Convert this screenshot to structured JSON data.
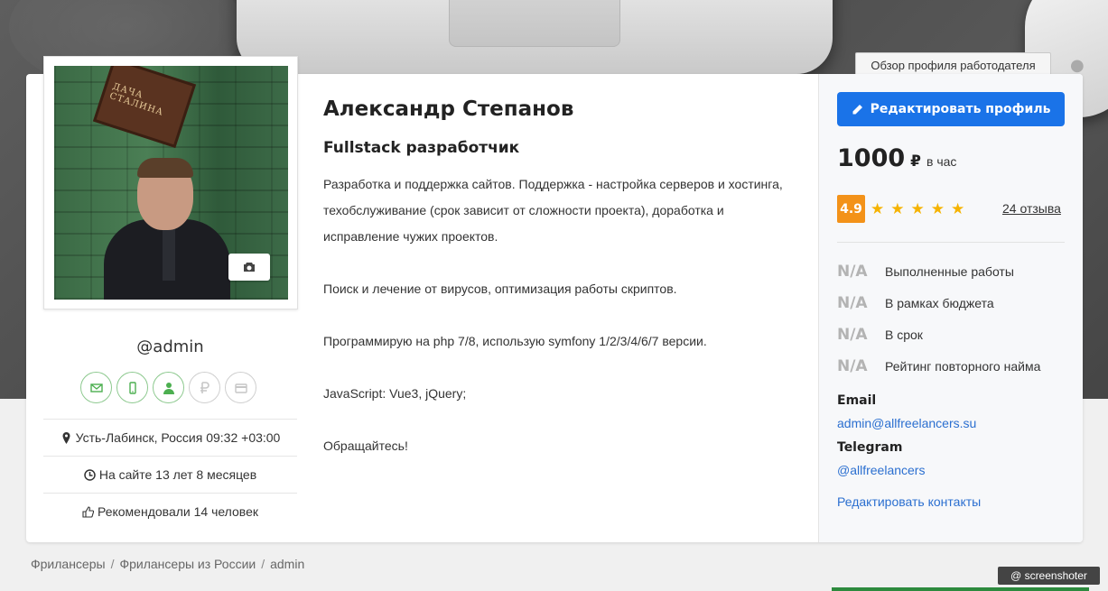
{
  "header": {
    "employer_view_label": "Обзор профиля работодателя"
  },
  "profile": {
    "name": "Александр Степанов",
    "specialization": "Fullstack разработчик",
    "description": "Разработка и поддержка сайтов. Поддержка - настройка серверов и хостинга, техобслуживание (срок зависит от сложности проекта), доработка и исправление чужих проектов.\n\nПоиск и лечение от вирусов, оптимизация работы скриптов.\n\nПрограммирую на php 7/8, использую symfony 1/2/3/4/6/7 версии.\n\nJavaScript: Vue3, jQuery;\n\nОбращайтесь!",
    "username": "@admin",
    "photo_sign_text": "ДАЧА СТАЛИНА",
    "location": "Усть-Лабинск, Россия 09:32 +03:00",
    "on_site": "На сайте 13 лет 8 месяцев",
    "recommended": "Рекомендовали 14 человек"
  },
  "sidebar": {
    "edit_profile_label": "Редактировать профиль",
    "rate_value": "1000",
    "rate_currency": "₽",
    "rate_unit": "в час",
    "rating": "4.9",
    "stars": 5,
    "reviews_label": "24 отзыва",
    "stats": [
      {
        "value": "N/A",
        "label": "Выполненные работы"
      },
      {
        "value": "N/A",
        "label": "В рамках бюджета"
      },
      {
        "value": "N/A",
        "label": "В срок"
      },
      {
        "value": "N/A",
        "label": "Рейтинг повторного найма"
      }
    ],
    "email_label": "Email",
    "email_value": "admin@allfreelancers.su",
    "telegram_label": "Telegram",
    "telegram_value": "@allfreelancers",
    "edit_contacts_label": "Редактировать контакты"
  },
  "breadcrumb": [
    "Фрилансеры",
    "Фрилансеры из России",
    "admin"
  ],
  "watermark": "@ screenshoter",
  "colors": {
    "accent": "#1a73e8",
    "rating": "#f39219",
    "star": "#f5b301",
    "link": "#2b6fd0",
    "verified": "#4caf50"
  }
}
